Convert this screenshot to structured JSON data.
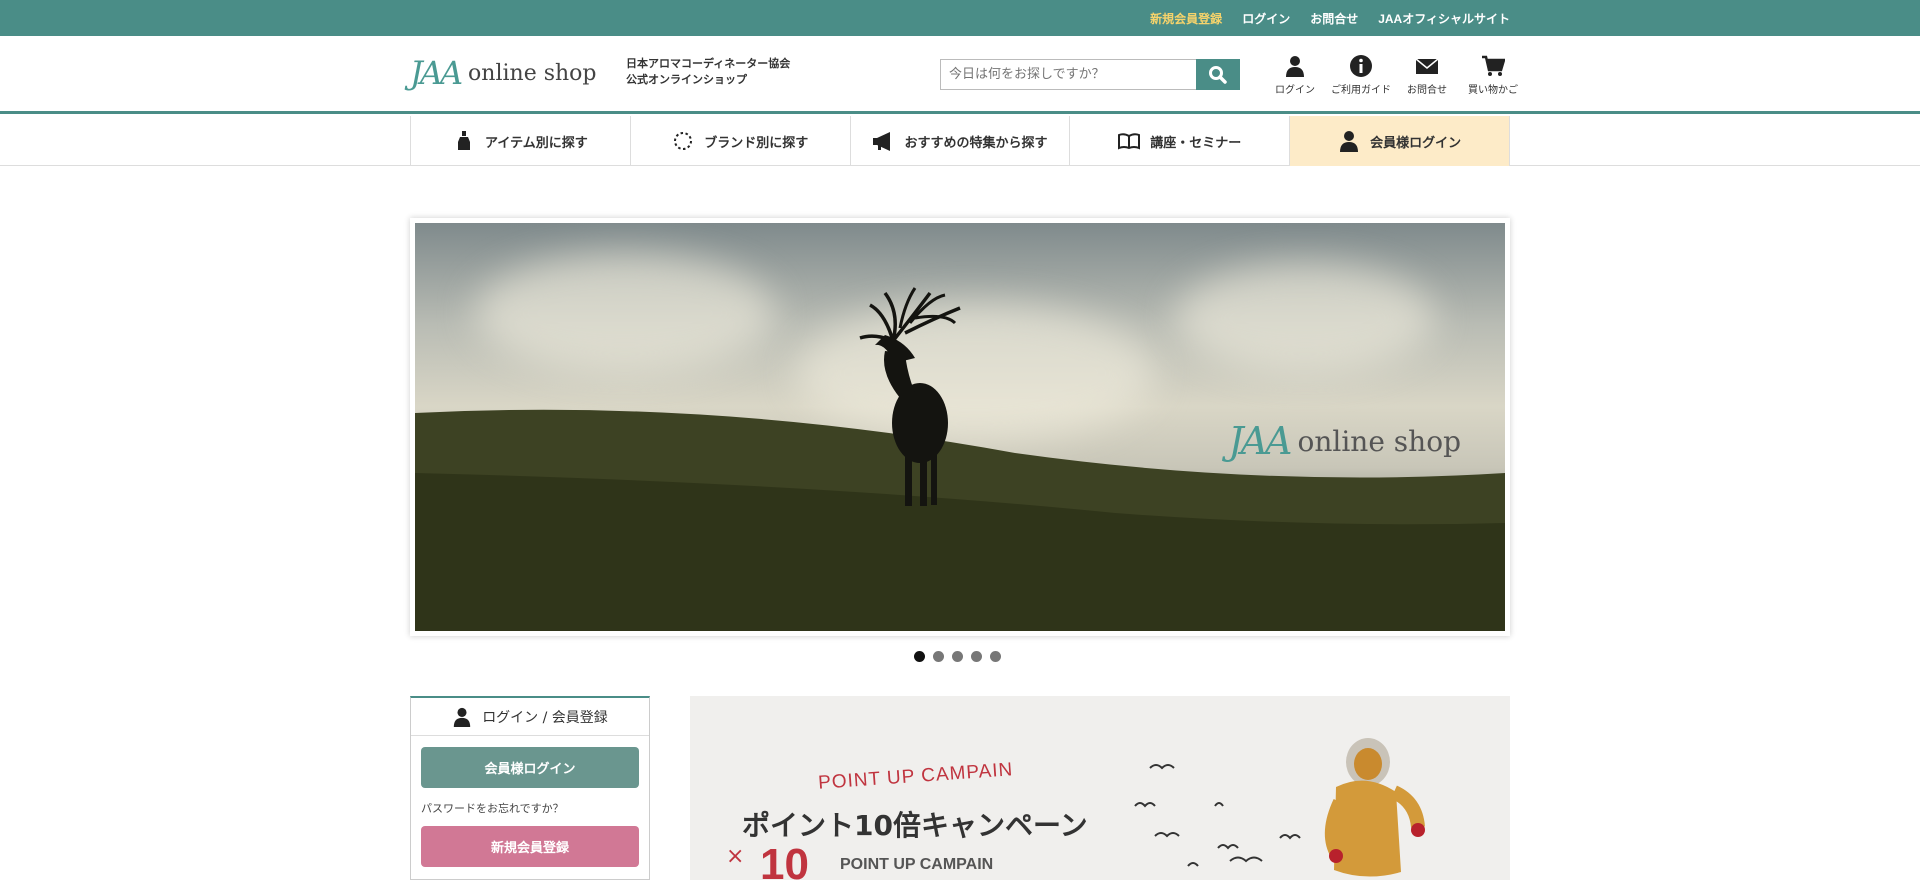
{
  "topbar": {
    "links": [
      "新規会員登録",
      "ログイン",
      "お問合せ",
      "JAAオフィシャルサイト"
    ]
  },
  "header": {
    "logo_mark": "JAA",
    "logo_text": "online shop",
    "tagline_line1": "日本アロマコーディネーター協会",
    "tagline_line2": "公式オンラインショップ",
    "search_placeholder": "今日は何をお探しですか？",
    "icons": [
      {
        "label": "ログイン",
        "icon": "user-icon"
      },
      {
        "label": "ご利用ガイド",
        "icon": "info-icon"
      },
      {
        "label": "お問合せ",
        "icon": "mail-icon"
      },
      {
        "label": "買い物かご",
        "icon": "cart-icon"
      }
    ]
  },
  "nav": {
    "items": [
      {
        "label": "アイテム別に探す",
        "icon": "bottle-icon"
      },
      {
        "label": "ブランド別に探す",
        "icon": "circle-dots-icon"
      },
      {
        "label": "おすすめの特集から探す",
        "icon": "megaphone-icon"
      },
      {
        "label": "講座・セミナー",
        "icon": "book-icon"
      },
      {
        "label": "会員様ログイン",
        "icon": "user-icon"
      }
    ]
  },
  "hero": {
    "logo_mark": "JAA",
    "logo_text": "online shop",
    "slide_count": 5,
    "active_slide": 1
  },
  "login_box": {
    "title": "ログイン / 会員登録",
    "member_login": "会員様ログイン",
    "forgot_password": "パスワードをお忘れですか？",
    "register": "新規会員登録"
  },
  "campaign": {
    "subtitle": "POINT UP CAMPAIN",
    "title": "ポイント10倍キャンペーン",
    "multiplier_x": "×",
    "multiplier": "10",
    "label": "POINT UP CAMPAIN"
  },
  "colors": {
    "brand": "#4a8d87",
    "highlight": "#f6d36b",
    "member_button": "#6a968f",
    "register_button": "#d17895",
    "campaign_red": "#c0343f",
    "nav_login_bg": "#fdebc8"
  }
}
